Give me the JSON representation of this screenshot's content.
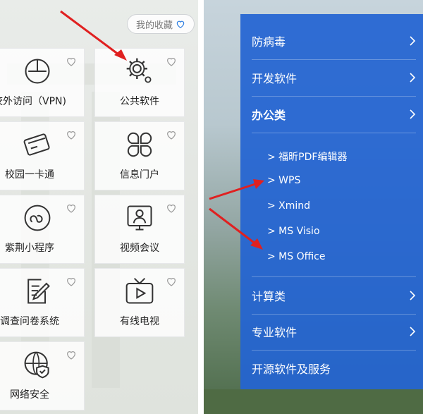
{
  "favorites_label": "我的收藏",
  "tiles": [
    {
      "label": "校外访问（VPN)",
      "icon": "mouse-icon"
    },
    {
      "label": "公共软件",
      "icon": "gear-icon"
    },
    {
      "label": "校园一卡通",
      "icon": "card-icon"
    },
    {
      "label": "信息门户",
      "icon": "clover-icon"
    },
    {
      "label": "紫荆小程序",
      "icon": "miniprogram-icon"
    },
    {
      "label": "视频会议",
      "icon": "video-meeting-icon"
    },
    {
      "label": "调查问卷系统",
      "icon": "survey-icon"
    },
    {
      "label": "有线电视",
      "icon": "tv-icon"
    },
    {
      "label": "网络安全",
      "icon": "shield-icon"
    }
  ],
  "menu": {
    "items": [
      {
        "label": "防病毒"
      },
      {
        "label": "开发软件"
      },
      {
        "label": "办公类"
      },
      {
        "label": "计算类"
      },
      {
        "label": "专业软件"
      },
      {
        "label": "开源软件及服务"
      }
    ],
    "submenu": [
      {
        "label": "> 福昕PDF编辑器"
      },
      {
        "label": "> WPS"
      },
      {
        "label": "> Xmind"
      },
      {
        "label": "> MS Visio"
      },
      {
        "label": "> MS Office"
      }
    ]
  },
  "colors": {
    "panel": "#2364d2",
    "arrow": "#e02020"
  }
}
